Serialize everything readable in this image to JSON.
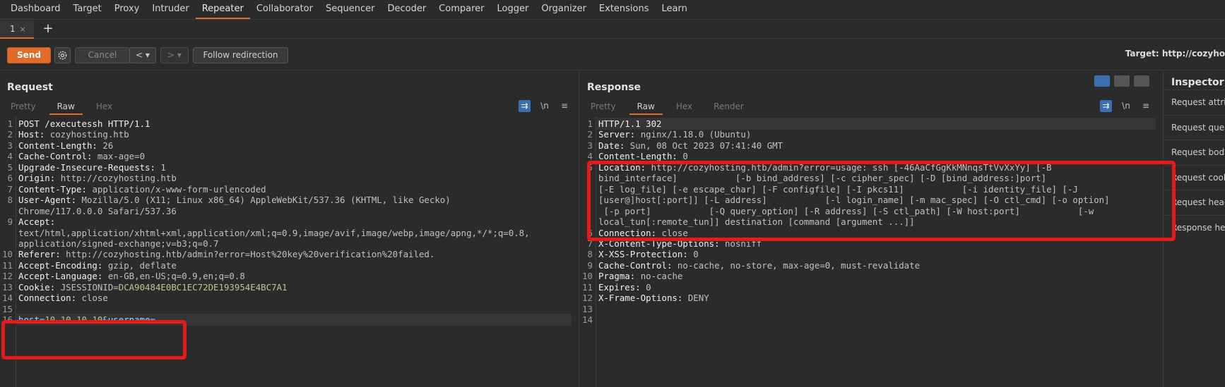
{
  "menu": [
    "Dashboard",
    "Target",
    "Proxy",
    "Intruder",
    "Repeater",
    "Collaborator",
    "Sequencer",
    "Decoder",
    "Comparer",
    "Logger",
    "Organizer",
    "Extensions",
    "Learn"
  ],
  "menu_active": "Repeater",
  "tab": {
    "label": "1",
    "close": "×",
    "add": "+"
  },
  "toolbar": {
    "send": "Send",
    "cancel": "Cancel",
    "back": "< ▾",
    "forward": "> ▾",
    "follow": "Follow redirection",
    "target": "Target: http://cozyho"
  },
  "request": {
    "title": "Request",
    "tabs": [
      "Pretty",
      "Raw",
      "Hex"
    ],
    "active_tab": "Raw",
    "newline_icon": "\\n",
    "menu_icon": "≡",
    "lines": [
      {
        "n": "1",
        "k": "POST /executessh HTTP/1.1",
        "v": ""
      },
      {
        "n": "2",
        "k": "Host: ",
        "v": "cozyhosting.htb"
      },
      {
        "n": "3",
        "k": "Content-Length: ",
        "v": "26"
      },
      {
        "n": "4",
        "k": "Cache-Control: ",
        "v": "max-age=0"
      },
      {
        "n": "5",
        "k": "Upgrade-Insecure-Requests: ",
        "v": "1"
      },
      {
        "n": "6",
        "k": "Origin: ",
        "v": "http://cozyhosting.htb"
      },
      {
        "n": "7",
        "k": "Content-Type: ",
        "v": "application/x-www-form-urlencoded"
      },
      {
        "n": "8",
        "k": "User-Agent: ",
        "v": "Mozilla/5.0 (X11; Linux x86_64) AppleWebKit/537.36 (KHTML, like Gecko)"
      },
      {
        "n": "",
        "k": "",
        "v": "Chrome/117.0.0.0 Safari/537.36"
      },
      {
        "n": "9",
        "k": "Accept:",
        "v": ""
      },
      {
        "n": "",
        "k": "",
        "v": "text/html,application/xhtml+xml,application/xml;q=0.9,image/avif,image/webp,image/apng,*/*;q=0.8,"
      },
      {
        "n": "",
        "k": "",
        "v": "application/signed-exchange;v=b3;q=0.7"
      },
      {
        "n": "10",
        "k": "Referer: ",
        "v": "http://cozyhosting.htb/admin?error=Host%20key%20verification%20failed."
      },
      {
        "n": "11",
        "k": "Accept-Encoding: ",
        "v": "gzip, deflate"
      },
      {
        "n": "12",
        "k": "Accept-Language: ",
        "v": "en-GB,en-US;q=0.9,en;q=0.8"
      },
      {
        "n": "13",
        "k": "Cookie: ",
        "v": "JSESSIONID=",
        "v2": "DCA90484E0BC1EC72DE193954E4BC7A1"
      },
      {
        "n": "14",
        "k": "Connection: ",
        "v": "close"
      },
      {
        "n": "15",
        "k": "",
        "v": ""
      },
      {
        "n": "16",
        "p1": "host=",
        "v2a": "10.10.10.10",
        "p2": "&username="
      }
    ]
  },
  "response": {
    "title": "Response",
    "tabs": [
      "Pretty",
      "Raw",
      "Hex",
      "Render"
    ],
    "active_tab": "Raw",
    "newline_icon": "\\n",
    "menu_icon": "≡",
    "lines": [
      {
        "n": "1",
        "k": "HTTP/1.1 302",
        "v": ""
      },
      {
        "n": "2",
        "k": "Server: ",
        "v": "nginx/1.18.0 (Ubuntu)"
      },
      {
        "n": "3",
        "k": "Date: ",
        "v": "Sun, 08 Oct 2023 07:41:40 GMT"
      },
      {
        "n": "4",
        "k": "Content-Length: ",
        "v": "0"
      },
      {
        "n": "5",
        "k": "Location: ",
        "v": "http://cozyhosting.htb/admin?error=usage: ssh [-46AaCfGgKkMNnqsTtVvXxYy] [-B"
      },
      {
        "n": "",
        "k": "",
        "v": "bind_interface]           [-b bind_address] [-c cipher_spec] [-D [bind_address:]port]"
      },
      {
        "n": "",
        "k": "",
        "v": "[-E log_file] [-e escape_char] [-F configfile] [-I pkcs11]           [-i identity_file] [-J"
      },
      {
        "n": "",
        "k": "",
        "v": "[user@]host[:port]] [-L address]           [-l login_name] [-m mac_spec] [-O ctl_cmd] [-o option]"
      },
      {
        "n": "",
        "k": "",
        "v": " [-p port]           [-Q query_option] [-R address] [-S ctl_path] [-W host:port]           [-w"
      },
      {
        "n": "",
        "k": "",
        "v": "local_tun[:remote_tun]] destination [command [argument ...]]"
      },
      {
        "n": "6",
        "k": "Connection: ",
        "v": "close"
      },
      {
        "n": "7",
        "k": "X-Content-Type-Options: ",
        "v": "nosniff"
      },
      {
        "n": "8",
        "k": "X-XSS-Protection: ",
        "v": "0"
      },
      {
        "n": "9",
        "k": "Cache-Control: ",
        "v": "no-cache, no-store, max-age=0, must-revalidate"
      },
      {
        "n": "10",
        "k": "Pragma: ",
        "v": "no-cache"
      },
      {
        "n": "11",
        "k": "Expires: ",
        "v": "0"
      },
      {
        "n": "12",
        "k": "X-Frame-Options: ",
        "v": "DENY"
      },
      {
        "n": "13",
        "k": "",
        "v": ""
      },
      {
        "n": "14",
        "k": "",
        "v": ""
      }
    ]
  },
  "inspector": {
    "title": "Inspector",
    "items": [
      "Request attri",
      "Request quer",
      "Request body",
      "Request cook",
      "Request head",
      "Response hea"
    ]
  }
}
